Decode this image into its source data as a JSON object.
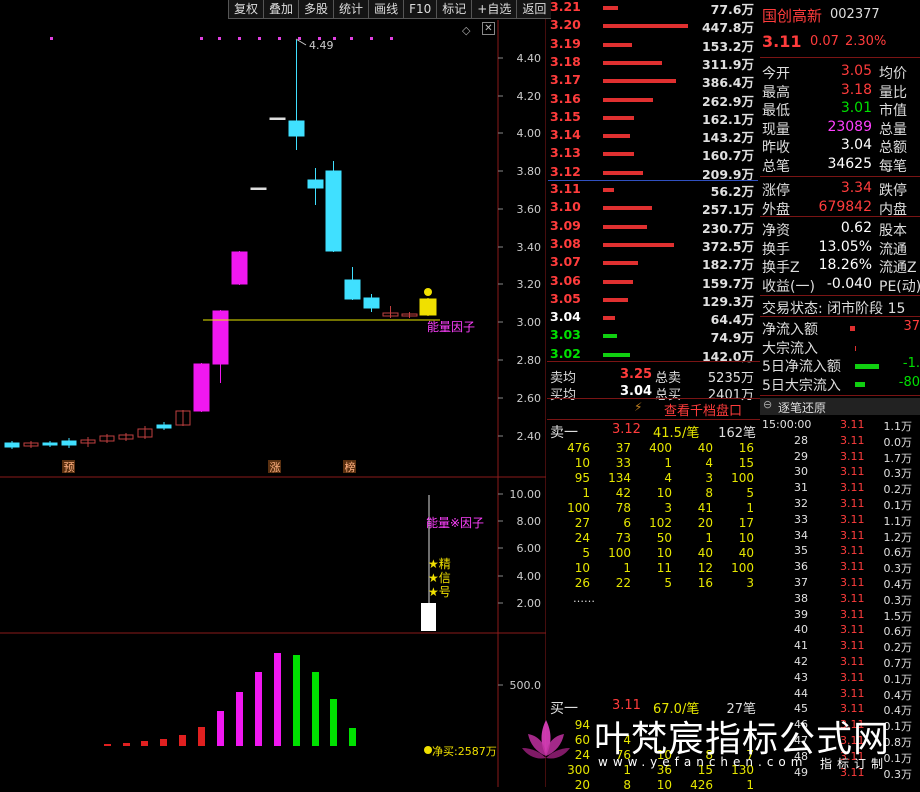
{
  "toolbar": [
    "复权",
    "叠加",
    "多股",
    "统计",
    "画线",
    "F10",
    "标记",
    "+自选",
    "返回"
  ],
  "chart_data": {
    "type": "candlestick",
    "y_axis_labels": [
      "4.40",
      "4.20",
      "4.00",
      "3.80",
      "3.60",
      "3.40",
      "3.20",
      "3.00",
      "2.80",
      "2.60",
      "2.40"
    ],
    "max_label": "4.49",
    "candle_labels": [
      "预",
      "涨",
      "榜"
    ],
    "energy_label": "能量因子",
    "ind_axis_labels": [
      "10.00",
      "8.00",
      "6.00",
      "4.00",
      "2.00"
    ],
    "ind_title": "能量※因子",
    "stars": [
      "精",
      "信",
      "号"
    ],
    "vol_axis_label": "500.0",
    "net_buy": "净买:2587万"
  },
  "ask_levels": [
    {
      "p": "3.21",
      "v": "77.6万"
    },
    {
      "p": "3.20",
      "v": "447.8万"
    },
    {
      "p": "3.19",
      "v": "153.2万"
    },
    {
      "p": "3.18",
      "v": "311.9万"
    },
    {
      "p": "3.17",
      "v": "386.4万"
    },
    {
      "p": "3.16",
      "v": "262.9万"
    },
    {
      "p": "3.15",
      "v": "162.1万"
    },
    {
      "p": "3.14",
      "v": "143.2万"
    },
    {
      "p": "3.13",
      "v": "160.7万"
    },
    {
      "p": "3.12",
      "v": "209.9万"
    }
  ],
  "bid_levels": [
    {
      "p": "3.11",
      "v": "56.2万"
    },
    {
      "p": "3.10",
      "v": "257.1万"
    },
    {
      "p": "3.09",
      "v": "230.7万"
    },
    {
      "p": "3.08",
      "v": "372.5万"
    },
    {
      "p": "3.07",
      "v": "182.7万"
    },
    {
      "p": "3.06",
      "v": "159.7万"
    },
    {
      "p": "3.05",
      "v": "129.3万"
    },
    {
      "p": "3.04",
      "v": "64.4万"
    },
    {
      "p": "3.03",
      "v": "74.9万"
    },
    {
      "p": "3.02",
      "v": "142.0万"
    }
  ],
  "summary": {
    "sell_avg_k": "卖均",
    "sell_avg": "3.25",
    "sell_total_k": "总卖",
    "sell_total": "5235万",
    "buy_avg_k": "买均",
    "buy_avg": "3.04",
    "buy_total_k": "总买",
    "buy_total": "2401万",
    "qiandang": "查看千档盘口"
  },
  "queue": {
    "sell1_k": "卖一",
    "sell1_p": "3.12",
    "sell1_avg": "41.5/笔",
    "sell1_n": "162笔",
    "sell_rows": [
      [
        "476",
        "37",
        "400",
        "40",
        "16"
      ],
      [
        "10",
        "33",
        "1",
        "4",
        "15"
      ],
      [
        "95",
        "134",
        "4",
        "3",
        "100"
      ],
      [
        "1",
        "42",
        "10",
        "8",
        "5"
      ],
      [
        "100",
        "78",
        "3",
        "41",
        "1"
      ],
      [
        "27",
        "6",
        "102",
        "20",
        "17"
      ],
      [
        "24",
        "73",
        "50",
        "1",
        "10"
      ],
      [
        "5",
        "100",
        "10",
        "40",
        "40"
      ],
      [
        "10",
        "1",
        "11",
        "12",
        "100"
      ],
      [
        "26",
        "22",
        "5",
        "16",
        "3"
      ]
    ],
    "more": "……",
    "buy1_k": "买一",
    "buy1_p": "3.11",
    "buy1_avg": "67.0/笔",
    "buy1_n": "27笔",
    "buy_rows": [
      [
        "94",
        "",
        "",
        "",
        ""
      ],
      [
        "60",
        "4",
        "",
        "",
        ""
      ],
      [
        "24",
        "76",
        "10",
        "8",
        "7"
      ],
      [
        "300",
        "1",
        "36",
        "15",
        "130"
      ],
      [
        "20",
        "8",
        "10",
        "426",
        "1"
      ]
    ]
  },
  "stock": {
    "name": "国创高新",
    "code": "002377",
    "price": "3.11",
    "change": "0.07",
    "pct": "2.30%"
  },
  "info": [
    {
      "k": "今开",
      "v": "3.05",
      "c": "red",
      "k2": "均价"
    },
    {
      "k": "最高",
      "v": "3.18",
      "c": "red",
      "k2": "量比"
    },
    {
      "k": "最低",
      "v": "3.01",
      "c": "green",
      "k2": "市值"
    },
    {
      "k": "现量",
      "v": "23089",
      "c": "mag",
      "k2": "总量"
    },
    {
      "k": "昨收",
      "v": "3.04",
      "c": "white",
      "k2": "总额"
    },
    {
      "k": "总笔",
      "v": "34625",
      "c": "white",
      "k2": "每笔"
    },
    {
      "k": "涨停",
      "v": "3.34",
      "c": "red",
      "k2": "跌停"
    },
    {
      "k": "外盘",
      "v": "679842",
      "c": "red",
      "k2": "内盘"
    },
    {
      "k": "净资",
      "v": "0.62",
      "c": "white",
      "k2": "股本"
    },
    {
      "k": "换手",
      "v": "13.05%",
      "c": "white",
      "k2": "流通"
    },
    {
      "k": "换手Z",
      "v": "18.26%",
      "c": "white",
      "k2": "流通Z"
    },
    {
      "k": "收益(一)",
      "v": "-0.040",
      "c": "white",
      "k2": "PE(动)"
    }
  ],
  "status": "交易状态: 闭市阶段 15",
  "flows": [
    {
      "k": "净流入额",
      "v": "37"
    },
    {
      "k": "大宗流入",
      "v": ""
    },
    {
      "k": "5日净流入额",
      "v": "-1."
    },
    {
      "k": "5日大宗流入",
      "v": "-80"
    }
  ],
  "ticks_header": "逐笔还原",
  "ticks": [
    {
      "t": "15:00:00",
      "p": "3.11",
      "v": "1.1万"
    },
    {
      "t": "28",
      "p": "3.11",
      "v": "0.0万"
    },
    {
      "t": "29",
      "p": "3.11",
      "v": "1.7万"
    },
    {
      "t": "30",
      "p": "3.11",
      "v": "0.3万"
    },
    {
      "t": "31",
      "p": "3.11",
      "v": "0.2万"
    },
    {
      "t": "32",
      "p": "3.11",
      "v": "0.1万"
    },
    {
      "t": "33",
      "p": "3.11",
      "v": "1.1万"
    },
    {
      "t": "34",
      "p": "3.11",
      "v": "1.2万"
    },
    {
      "t": "35",
      "p": "3.11",
      "v": "0.6万"
    },
    {
      "t": "36",
      "p": "3.11",
      "v": "0.3万"
    },
    {
      "t": "37",
      "p": "3.11",
      "v": "0.4万"
    },
    {
      "t": "38",
      "p": "3.11",
      "v": "0.3万"
    },
    {
      "t": "39",
      "p": "3.11",
      "v": "1.5万"
    },
    {
      "t": "40",
      "p": "3.11",
      "v": "0.6万"
    },
    {
      "t": "41",
      "p": "3.11",
      "v": "0.2万"
    },
    {
      "t": "42",
      "p": "3.11",
      "v": "0.7万"
    },
    {
      "t": "43",
      "p": "3.11",
      "v": "0.1万"
    },
    {
      "t": "44",
      "p": "3.11",
      "v": "0.4万"
    },
    {
      "t": "45",
      "p": "3.11",
      "v": "0.4万"
    },
    {
      "t": "46",
      "p": "3.11",
      "v": "0.1万"
    },
    {
      "t": "47",
      "p": "3.11",
      "v": "0.8万"
    },
    {
      "t": "48",
      "p": "3.11",
      "v": "0.1万"
    },
    {
      "t": "49",
      "p": "3.11",
      "v": "0.3万"
    }
  ],
  "watermark": {
    "text": "叶梵宸指标公式网",
    "url": "www.yefanchen.com",
    "sub": "指标订制"
  }
}
